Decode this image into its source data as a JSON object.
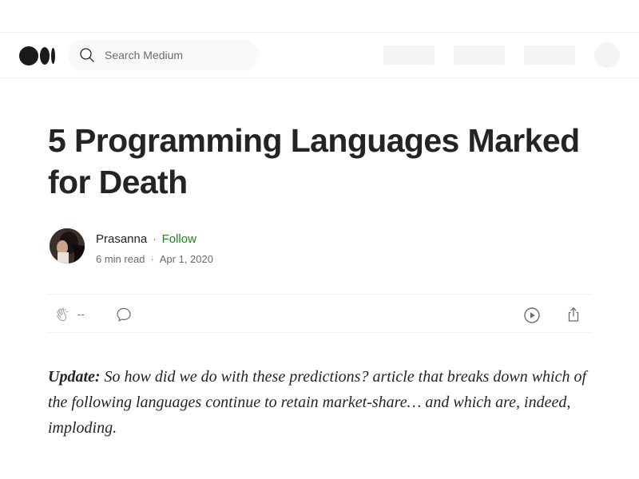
{
  "header": {
    "logo_name": "Medium",
    "search": {
      "placeholder": "Search Medium",
      "value": ""
    }
  },
  "article": {
    "title": "5 Programming Languages Marked for Death",
    "author": {
      "name": "Prasanna",
      "follow_label": "Follow",
      "read_time": "6 min read",
      "date": "Apr 1, 2020"
    },
    "actions": {
      "clap_count": "--"
    },
    "body": {
      "lead": "Update:",
      "text": " So how did we do with these predictions? article that breaks down which of the following languages continue to retain market-share… and which are, indeed, imploding."
    }
  },
  "colors": {
    "text": "#242424",
    "muted": "#6b6b6b",
    "follow": "#1a8917",
    "logo": "#1a1a1a"
  },
  "icons": [
    "search-icon",
    "clap-icon",
    "response-icon",
    "play-icon",
    "share-icon"
  ]
}
